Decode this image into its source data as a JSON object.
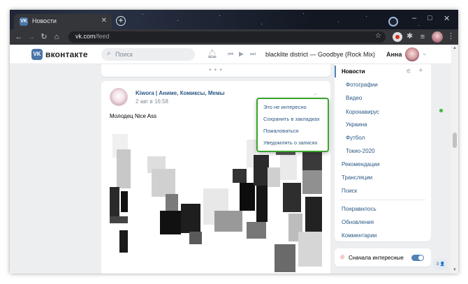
{
  "browser": {
    "tab_title": "Новости",
    "tab_favicon": "vk-icon",
    "url_domain": "vk.com",
    "url_path": "/feed",
    "new_tab_label": "+",
    "window_controls": [
      "–",
      "□",
      "✕"
    ]
  },
  "header": {
    "logo_text": "вконтакте",
    "logo_badge": "VK",
    "search_placeholder": "Поиск",
    "track": "blacklite district — Goodbye (Rock Mix)",
    "user_name": "Анна"
  },
  "post": {
    "author": "Kiwora | Аниме, Комиксы, Мемы",
    "date": "2 авг в 16:58",
    "text": "Молодец Nice Ass"
  },
  "dropdown": {
    "items": [
      "Это не интересно",
      "Сохранить в закладках",
      "Пожаловаться",
      "Уведомлять о записях"
    ],
    "border_color": "#3aa52c"
  },
  "right_menu": {
    "news": "Новости",
    "sub_items": [
      "Фотографии",
      "Видео",
      "Коронавирус",
      "Украина",
      "Футбол",
      "Токио-2020"
    ],
    "main_items": [
      "Рекомендации",
      "Трансляции",
      "Поиск"
    ],
    "extra_items": [
      "Понравилось",
      "Обновления",
      "Комментарии"
    ]
  },
  "sort": {
    "label": "Сначала интересные",
    "enabled": true
  },
  "chat_button": "3 👤",
  "colors": {
    "vk_blue": "#4a76a8",
    "link": "#2a5885",
    "status_green": "#4bb34b"
  }
}
